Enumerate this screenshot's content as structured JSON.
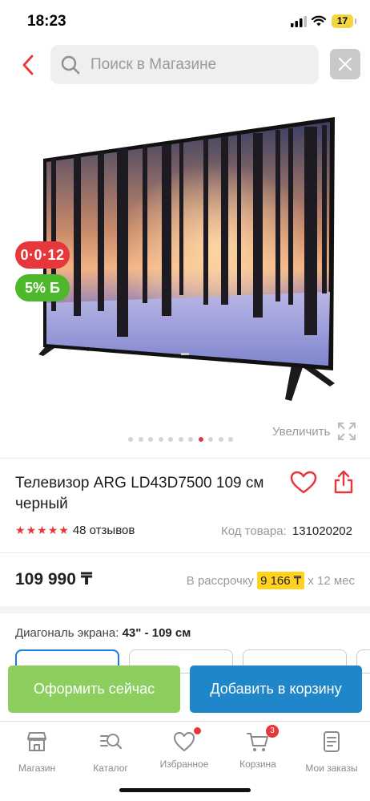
{
  "status_bar": {
    "time": "18:23",
    "battery": "17"
  },
  "search": {
    "placeholder": "Поиск в Магазине"
  },
  "badges": {
    "installment": "0·0·12",
    "bonus": "5% Б"
  },
  "gallery": {
    "zoom_label": "Увеличить",
    "total_images": 11,
    "active_index": 7
  },
  "product": {
    "title": "Телевизор ARG LD43D7500 109 см черный",
    "rating": 5,
    "reviews": "48 отзывов",
    "code_label": "Код товара:",
    "code_value": "131020202",
    "price": "109 990 ₸",
    "installment_prefix": "В рассрочку",
    "installment_amount": "9 166 ₸",
    "installment_suffix": "x 12 мес",
    "diagonal_label": "Диагональ экрана:",
    "diagonal_value": "43\" - 109 см"
  },
  "actions": {
    "checkout": "Оформить сейчас",
    "add_to_cart": "Добавить в корзину"
  },
  "nav": [
    {
      "label": "Магазин",
      "icon": "store-icon"
    },
    {
      "label": "Каталог",
      "icon": "catalog-search-icon"
    },
    {
      "label": "Избранное",
      "icon": "heart-icon"
    },
    {
      "label": "Корзина",
      "icon": "cart-icon",
      "badge": "3"
    },
    {
      "label": "Мои заказы",
      "icon": "orders-icon"
    }
  ],
  "colors": {
    "accent_red": "#e8373a",
    "bonus_green": "#4db82b",
    "checkout_green": "#8ccf5f",
    "cart_blue": "#1f86c9",
    "installment_yellow": "#ffd21f"
  }
}
